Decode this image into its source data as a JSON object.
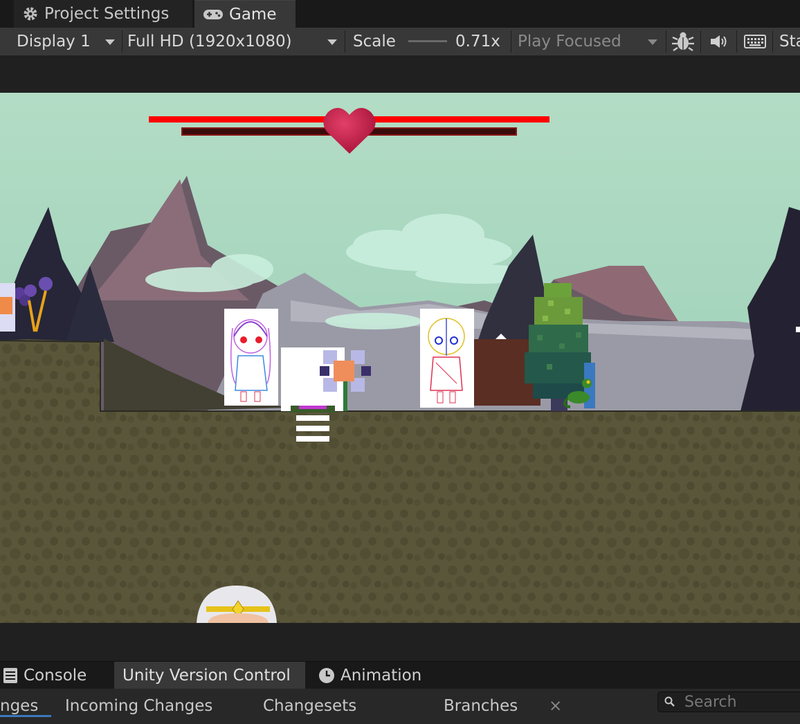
{
  "editor_tabs": [
    {
      "label": "Project Settings",
      "icon": "gear-icon"
    },
    {
      "label": "Game",
      "icon": "gamepad-icon"
    }
  ],
  "toolbar": {
    "display": "Display 1",
    "resolution": "Full HD (1920x1080)",
    "scale_label": "Scale",
    "scale_value": "0.71x",
    "play_mode": "Play Focused",
    "stats_label": "Sta"
  },
  "game_hud": {
    "health_fraction": 1.0
  },
  "bottom_tabs": [
    {
      "label": "Console",
      "icon": "console-icon"
    },
    {
      "label": "Unity Version Control"
    },
    {
      "label": "Animation",
      "icon": "clock-icon"
    }
  ],
  "vc_tabs": {
    "changes": "nges",
    "incoming": "Incoming Changes",
    "changesets": "Changesets",
    "branches": "Branches",
    "close": "×",
    "search_placeholder": "Search"
  },
  "colors": {
    "health_bar": "#ff0000",
    "sky_top": "#b2dcc4",
    "ground": "#59553a"
  }
}
